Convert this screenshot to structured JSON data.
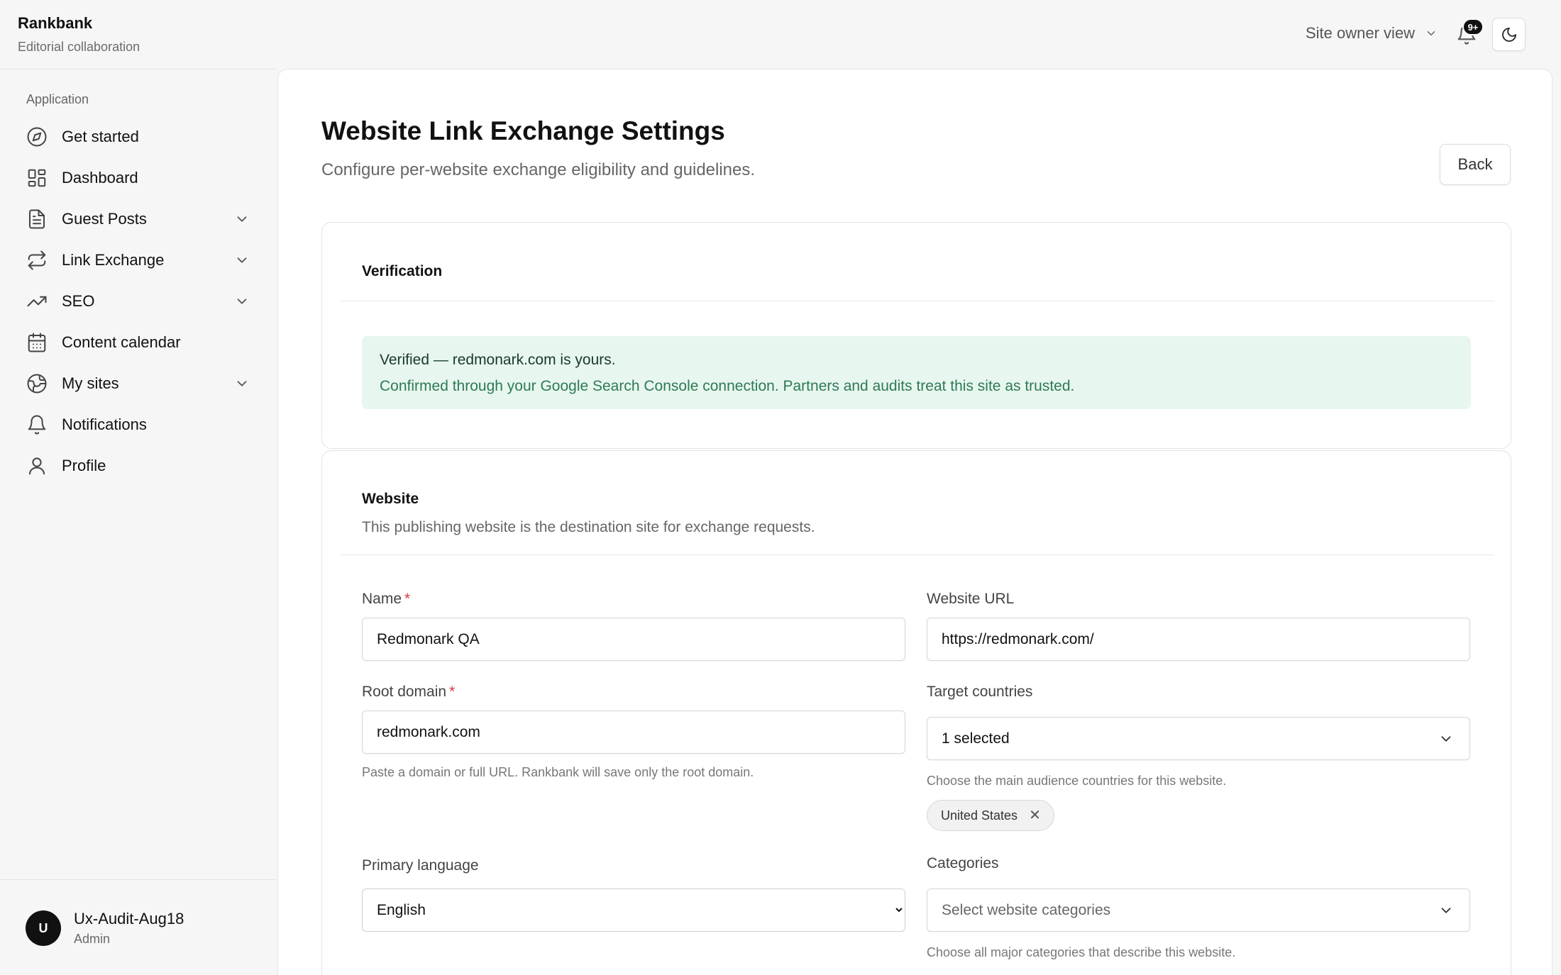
{
  "header": {
    "brand": "Rankbank",
    "brand_sub": "Editorial collaboration",
    "view_label": "Site owner view",
    "notifications_badge": "9+"
  },
  "sidebar": {
    "section_label": "Application",
    "items": [
      {
        "label": "Get started",
        "icon": "compass-icon",
        "expandable": false
      },
      {
        "label": "Dashboard",
        "icon": "dashboard-grid-icon",
        "expandable": false
      },
      {
        "label": "Guest Posts",
        "icon": "document-icon",
        "expandable": true
      },
      {
        "label": "Link Exchange",
        "icon": "exchange-arrows-icon",
        "expandable": true
      },
      {
        "label": "SEO",
        "icon": "trending-up-icon",
        "expandable": true
      },
      {
        "label": "Content calendar",
        "icon": "calendar-icon",
        "expandable": false
      },
      {
        "label": "My sites",
        "icon": "globe-icon",
        "expandable": true
      },
      {
        "label": "Notifications",
        "icon": "bell-icon",
        "expandable": false
      },
      {
        "label": "Profile",
        "icon": "user-icon",
        "expandable": false
      }
    ],
    "user": {
      "initial": "U",
      "name": "Ux-Audit-Aug18",
      "role": "Admin"
    }
  },
  "page": {
    "title": "Website Link Exchange Settings",
    "subtitle": "Configure per-website exchange eligibility and guidelines.",
    "back_label": "Back"
  },
  "verification": {
    "title": "Verification",
    "status": "Verified — redmonark.com is yours.",
    "message": "Confirmed through your Google Search Console connection. Partners and audits treat this site as trusted."
  },
  "website": {
    "title": "Website",
    "description": "This publishing website is the destination site for exchange requests.",
    "name_label": "Name",
    "name_value": "Redmonark QA",
    "url_label": "Website URL",
    "url_value": "https://redmonark.com/",
    "root_label": "Root domain",
    "root_value": "redmonark.com",
    "root_help": "Paste a domain or full URL. Rankbank will save only the root domain.",
    "countries_label": "Target countries",
    "countries_value": "1 selected",
    "countries_help": "Choose the main audience countries for this website.",
    "countries_chip": "United States",
    "language_label": "Primary language",
    "language_value": "English",
    "categories_label": "Categories",
    "categories_placeholder": "Select website categories",
    "categories_help": "Choose all major categories that describe this website."
  },
  "colors": {
    "verified_bg": "#e7f6ef",
    "verified_text": "#2f7a55",
    "required_mark": "#d23b3b"
  }
}
